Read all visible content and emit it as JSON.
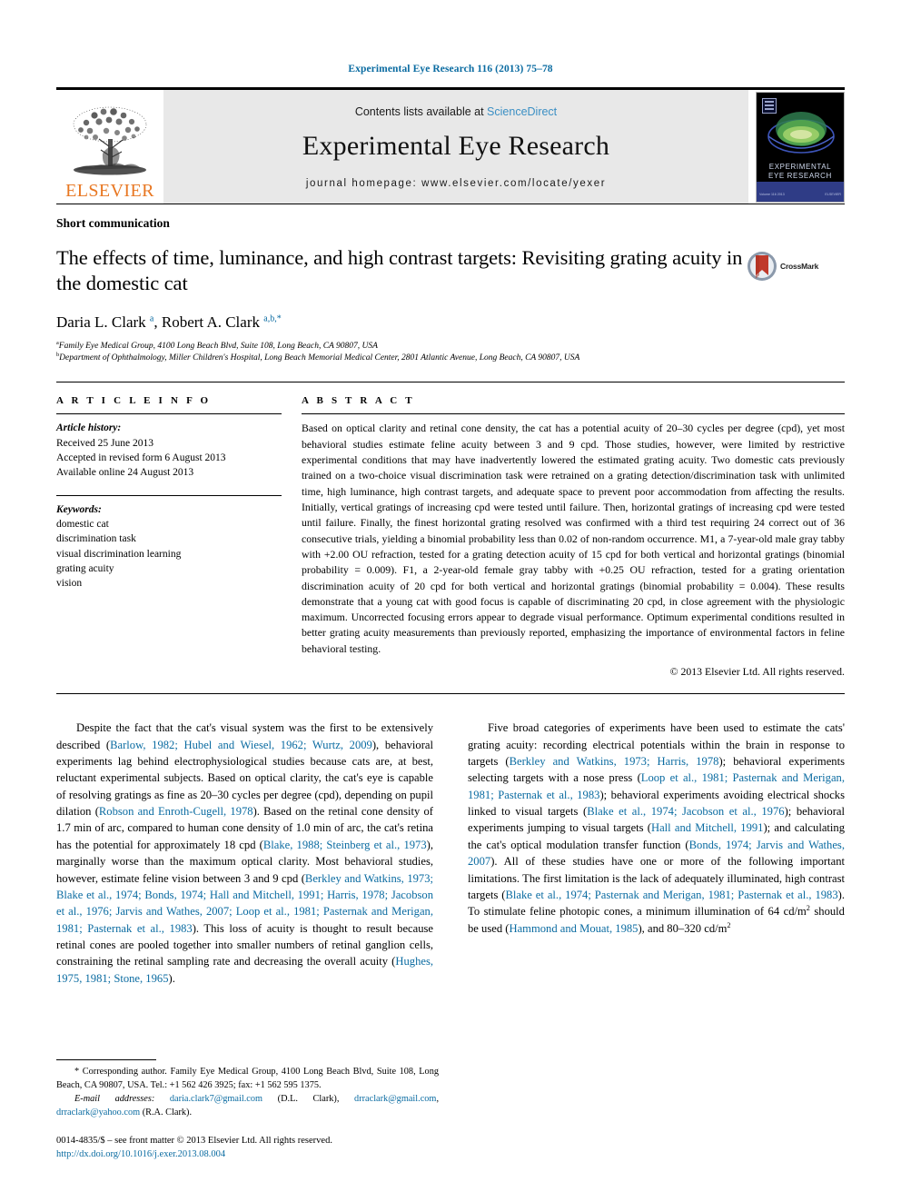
{
  "running_head": "Experimental Eye Research 116 (2013) 75–78",
  "masthead": {
    "publisher": "ELSEVIER",
    "contents_prefix": "Contents lists available at ",
    "contents_link": "ScienceDirect",
    "journal_name": "Experimental Eye Research",
    "homepage_label": "journal homepage: www.elsevier.com/locate/yexer",
    "cover_title_line1": "EXPERIMENTAL",
    "cover_title_line2": "EYE RESEARCH",
    "cover_tiny_left": "Volume 116  2013",
    "cover_tiny_right": "ELSEVIER"
  },
  "article": {
    "section_type": "Short communication",
    "title": "The effects of time, luminance, and high contrast targets: Revisiting grating acuity in the domestic cat",
    "crossmark_label": "CrossMark",
    "authors_html": "Daria L. Clark <sup>a</sup>, Robert A. Clark <sup>a,b,*</sup>",
    "affiliations": [
      {
        "marker": "a",
        "text": "Family Eye Medical Group, 4100 Long Beach Blvd, Suite 108, Long Beach, CA 90807, USA"
      },
      {
        "marker": "b",
        "text": "Department of Ophthalmology, Miller Children's Hospital, Long Beach Memorial Medical Center, 2801 Atlantic Avenue, Long Beach, CA 90807, USA"
      }
    ]
  },
  "article_info": {
    "heading": "A R T I C L E  I N F O",
    "history_label": "Article history:",
    "history": [
      "Received 25 June 2013",
      "Accepted in revised form 6 August 2013",
      "Available online 24 August 2013"
    ],
    "keywords_label": "Keywords:",
    "keywords": [
      "domestic cat",
      "discrimination task",
      "visual discrimination learning",
      "grating acuity",
      "vision"
    ]
  },
  "abstract": {
    "heading": "A B S T R A C T",
    "text": "Based on optical clarity and retinal cone density, the cat has a potential acuity of 20–30 cycles per degree (cpd), yet most behavioral studies estimate feline acuity between 3 and 9 cpd. Those studies, however, were limited by restrictive experimental conditions that may have inadvertently lowered the estimated grating acuity. Two domestic cats previously trained on a two-choice visual discrimination task were retrained on a grating detection/discrimination task with unlimited time, high luminance, high contrast targets, and adequate space to prevent poor accommodation from affecting the results. Initially, vertical gratings of increasing cpd were tested until failure. Then, horizontal gratings of increasing cpd were tested until failure. Finally, the finest horizontal grating resolved was confirmed with a third test requiring 24 correct out of 36 consecutive trials, yielding a binomial probability less than 0.02 of non-random occurrence. M1, a 7-year-old male gray tabby with +2.00 OU refraction, tested for a grating detection acuity of 15 cpd for both vertical and horizontal gratings (binomial probability = 0.009). F1, a 2-year-old female gray tabby with +0.25 OU refraction, tested for a grating orientation discrimination acuity of 20 cpd for both vertical and horizontal gratings (binomial probability = 0.004). These results demonstrate that a young cat with good focus is capable of discriminating 20 cpd, in close agreement with the physiologic maximum. Uncorrected focusing errors appear to degrade visual performance. Optimum experimental conditions resulted in better grating acuity measurements than previously reported, emphasizing the importance of environmental factors in feline behavioral testing.",
    "copyright": "© 2013 Elsevier Ltd. All rights reserved."
  },
  "body": {
    "left_paragraph_1": {
      "p1": "Despite the fact that the cat's visual system was the first to be extensively described (",
      "r1": "Barlow, 1982; Hubel and Wiesel, 1962; Wurtz, 2009",
      "p2": "), behavioral experiments lag behind electrophysiological studies because cats are, at best, reluctant experimental subjects. Based on optical clarity, the cat's eye is capable of resolving gratings as fine as 20–30 cycles per degree (cpd), depending on pupil dilation (",
      "r2": "Robson and Enroth-Cugell, 1978",
      "p3": "). Based on the retinal cone density of 1.7 min of arc, compared to human cone density of 1.0 min of arc, the cat's retina has the potential for approximately 18 cpd (",
      "r3": "Blake, 1988; Steinberg et al., 1973",
      "p4": "), marginally worse than the maximum optical clarity. Most behavioral studies, however, estimate feline vision between 3 and 9 cpd (",
      "r4": "Berkley and Watkins, 1973; Blake et al., 1974; Bonds, 1974; Hall and Mitchell, 1991; Harris, 1978; Jacobson et al., 1976; Jarvis and Wathes, 2007; Loop et al., 1981; Pasternak and Merigan, 1981; Pasternak et al., 1983",
      "p5": "). This loss of acuity is thought to result because retinal cones are pooled together into smaller numbers of retinal ganglion cells, constraining the retinal sampling rate and decreasing the overall acuity (",
      "r5": "Hughes, 1975, 1981; Stone, 1965",
      "p6": ")."
    },
    "right_paragraph_2": {
      "p1": "Five broad categories of experiments have been used to estimate the cats' grating acuity: recording electrical potentials within the brain in response to targets (",
      "r1": "Berkley and Watkins, 1973; Harris, 1978",
      "p2": "); behavioral experiments selecting targets with a nose press (",
      "r2": "Loop et al., 1981; Pasternak and Merigan, 1981; Pasternak et al., 1983",
      "p3": "); behavioral experiments avoiding electrical shocks linked to visual targets (",
      "r3": "Blake et al., 1974; Jacobson et al., 1976",
      "p4": "); behavioral experiments jumping to visual targets (",
      "r4": "Hall and Mitchell, 1991",
      "p5": "); and calculating the cat's optical modulation transfer function (",
      "r5": "Bonds, 1974; Jarvis and Wathes, 2007",
      "p6": "). All of these studies have one or more of the following important limitations. The first limitation is the lack of adequately illuminated, high contrast targets (",
      "r6": "Blake et al., 1974; Pasternak and Merigan, 1981; Pasternak et al., 1983",
      "p7": "). To stimulate feline photopic cones, a minimum illumination of 64 cd/m",
      "sup7": "2",
      "p8": " should be used (",
      "r7": "Hammond and Mouat, 1985",
      "p9": "), and 80–320 cd/m",
      "sup8": "2"
    }
  },
  "footnotes": {
    "corresponding": "* Corresponding author. Family Eye Medical Group, 4100 Long Beach Blvd, Suite 108, Long Beach, CA 90807, USA. Tel.: +1 562 426 3925; fax: +1 562 595 1375.",
    "email_label": "E-mail addresses:",
    "email1": "daria.clark7@gmail.com",
    "email1_owner": "(D.L. Clark),",
    "email2": "drraclark@gmail.com",
    "email2_sep": ",",
    "email3": "drraclark@yahoo.com",
    "email3_owner": "(R.A. Clark).",
    "issn_line": "0014-4835/$ – see front matter © 2013 Elsevier Ltd. All rights reserved.",
    "doi": "http://dx.doi.org/10.1016/j.exer.2013.08.004"
  },
  "colors": {
    "link_blue": "#0a6ba1",
    "sciencedirect_blue": "#3b8fc4",
    "elsevier_orange": "#E87722",
    "band_gray": "#e8e8e8"
  }
}
